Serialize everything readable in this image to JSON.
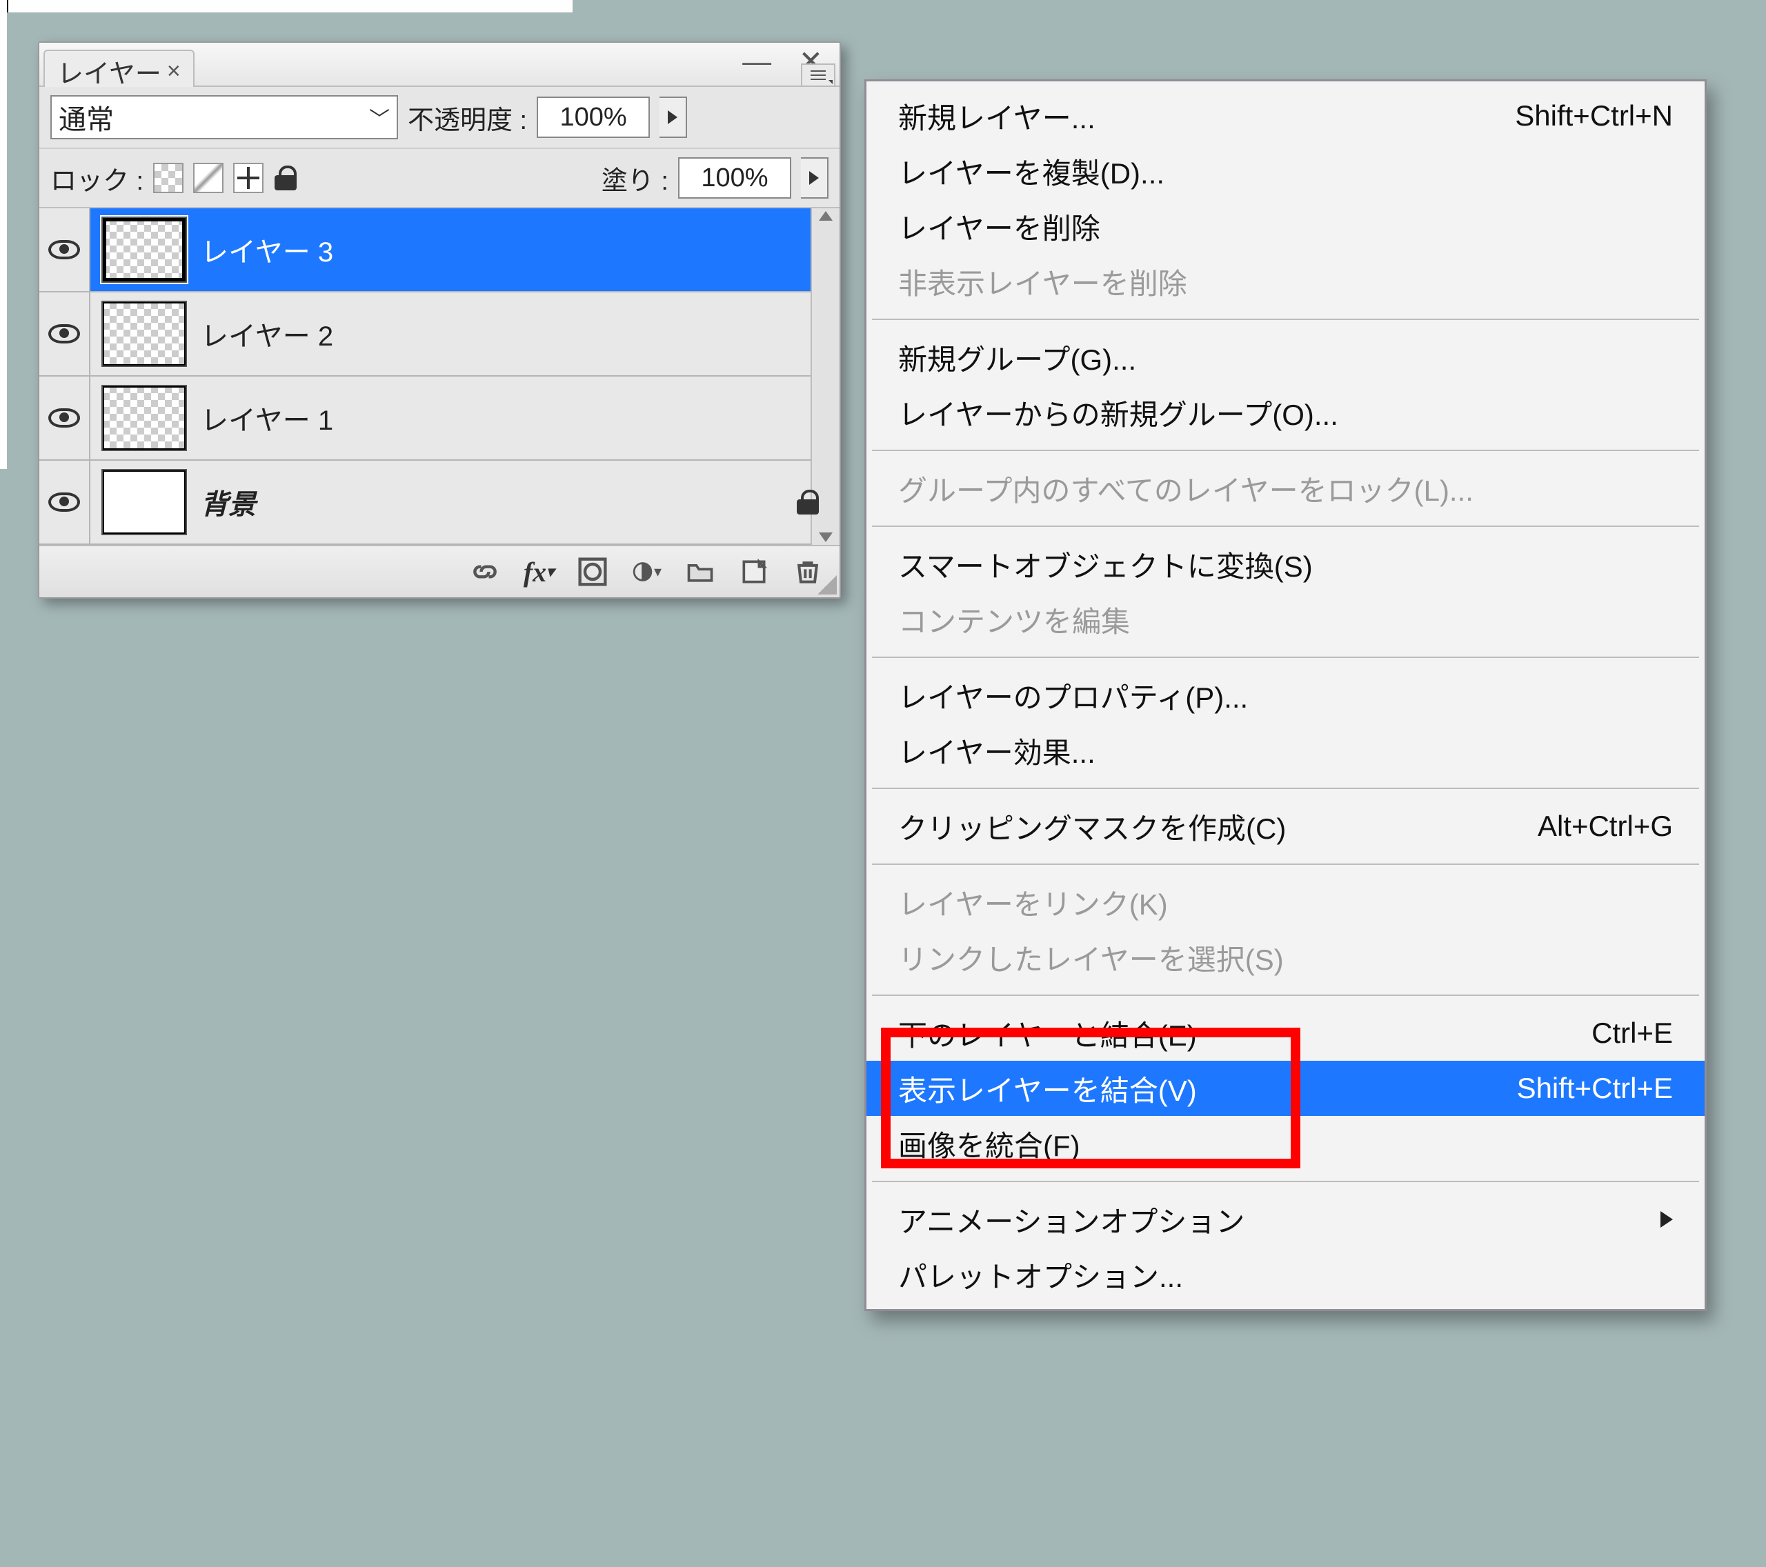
{
  "panel": {
    "tab_title": "レイヤー",
    "blend_mode": "通常",
    "opacity_label": "不透明度 :",
    "opacity_value": "100%",
    "lock_label": "ロック :",
    "fill_label": "塗り :",
    "fill_value": "100%",
    "layers": [
      {
        "name": "レイヤー 3",
        "selected": true,
        "bg": false
      },
      {
        "name": "レイヤー 2",
        "selected": false,
        "bg": false
      },
      {
        "name": "レイヤー 1",
        "selected": false,
        "bg": false
      },
      {
        "name": "背景",
        "selected": false,
        "bg": true
      }
    ]
  },
  "menu": {
    "groups": [
      [
        {
          "label": "新規レイヤー...",
          "shortcut": "Shift+Ctrl+N"
        },
        {
          "label": "レイヤーを複製(D)..."
        },
        {
          "label": "レイヤーを削除"
        },
        {
          "label": "非表示レイヤーを削除",
          "disabled": true
        }
      ],
      [
        {
          "label": "新規グループ(G)..."
        },
        {
          "label": "レイヤーからの新規グループ(O)..."
        }
      ],
      [
        {
          "label": "グループ内のすべてのレイヤーをロック(L)...",
          "disabled": true
        }
      ],
      [
        {
          "label": "スマートオブジェクトに変換(S)"
        },
        {
          "label": "コンテンツを編集",
          "disabled": true
        }
      ],
      [
        {
          "label": "レイヤーのプロパティ(P)..."
        },
        {
          "label": "レイヤー効果..."
        }
      ],
      [
        {
          "label": "クリッピングマスクを作成(C)",
          "shortcut": "Alt+Ctrl+G"
        }
      ],
      [
        {
          "label": "レイヤーをリンク(K)",
          "disabled": true
        },
        {
          "label": "リンクしたレイヤーを選択(S)",
          "disabled": true
        }
      ],
      [
        {
          "label": "下のレイヤーと結合(E)",
          "shortcut": "Ctrl+E"
        },
        {
          "label": "表示レイヤーを結合(V)",
          "shortcut": "Shift+Ctrl+E",
          "highlight": true,
          "red_emphasis": true
        },
        {
          "label": "画像を統合(F)"
        }
      ],
      [
        {
          "label": "アニメーションオプション",
          "submenu": true
        },
        {
          "label": "パレットオプション..."
        }
      ]
    ]
  }
}
